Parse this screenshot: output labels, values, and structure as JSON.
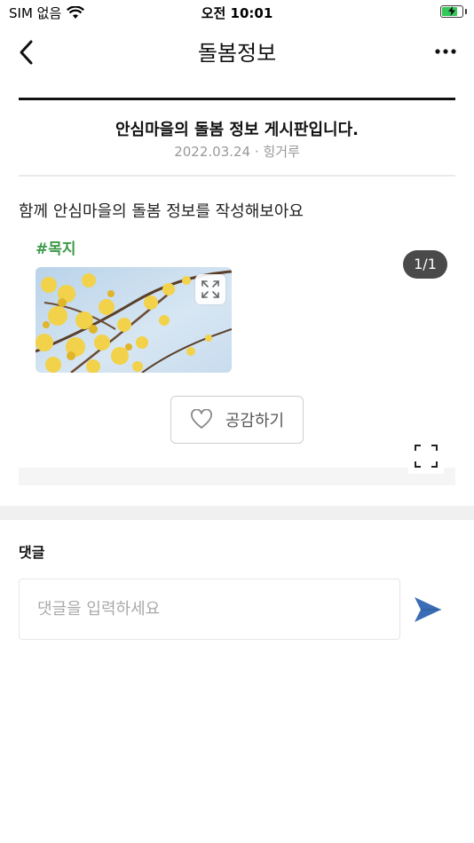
{
  "status_bar": {
    "carrier": "SIM 없음",
    "time": "오전 10:01",
    "battery_percent": 70,
    "icons": [
      "wifi-icon",
      "battery-charging-icon"
    ]
  },
  "nav": {
    "title": "돌봄정보",
    "back_icon": "chevron-left-icon",
    "more_icon": "more-horizontal-icon"
  },
  "post": {
    "title": "안심마을의 돌봄 정보 게시판입니다.",
    "meta": "2022.03.24 · 힝거루",
    "body": "함께 안심마을의 돌봄 정보를 작성해보아요",
    "tag": "#목지",
    "image_counter": "1/1",
    "like_label": "공감하기"
  },
  "comments": {
    "label": "댓글",
    "placeholder": "댓글을 입력하세요",
    "value": ""
  },
  "colors": {
    "tag": "#3f9a4a",
    "send": "#3b6cb5",
    "counter_bg": "#4a4a4a"
  }
}
